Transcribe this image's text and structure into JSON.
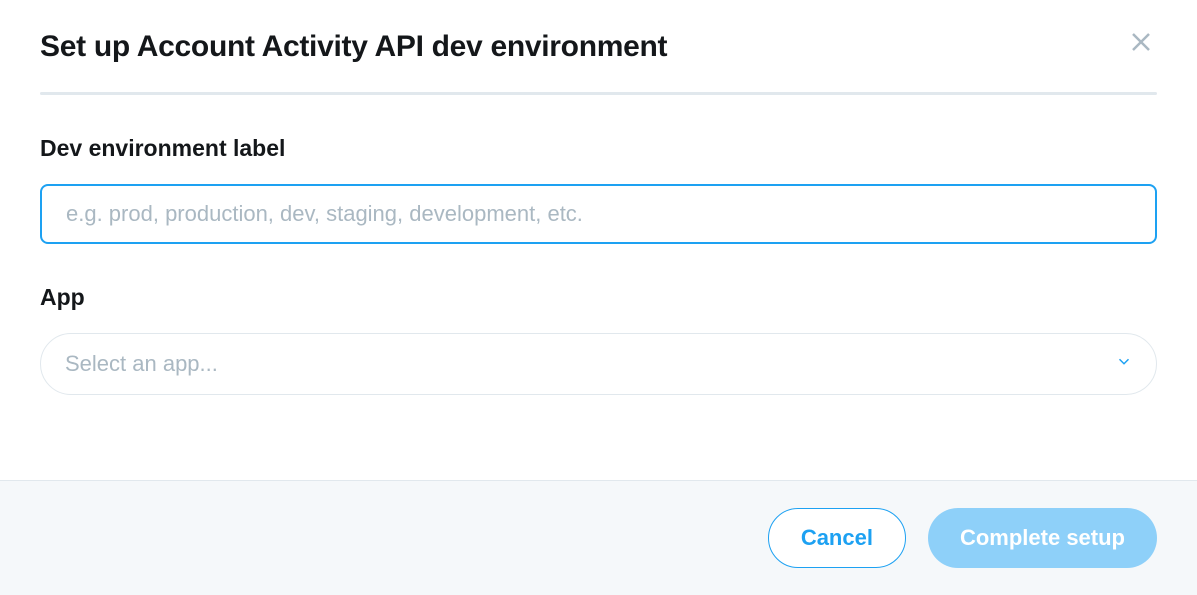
{
  "dialog": {
    "title": "Set up Account Activity API dev environment"
  },
  "form": {
    "env_label": {
      "label": "Dev environment label",
      "placeholder": "e.g. prod, production, dev, staging, development, etc.",
      "value": ""
    },
    "app": {
      "label": "App",
      "placeholder": "Select an app..."
    }
  },
  "footer": {
    "cancel_label": "Cancel",
    "complete_label": "Complete setup"
  }
}
